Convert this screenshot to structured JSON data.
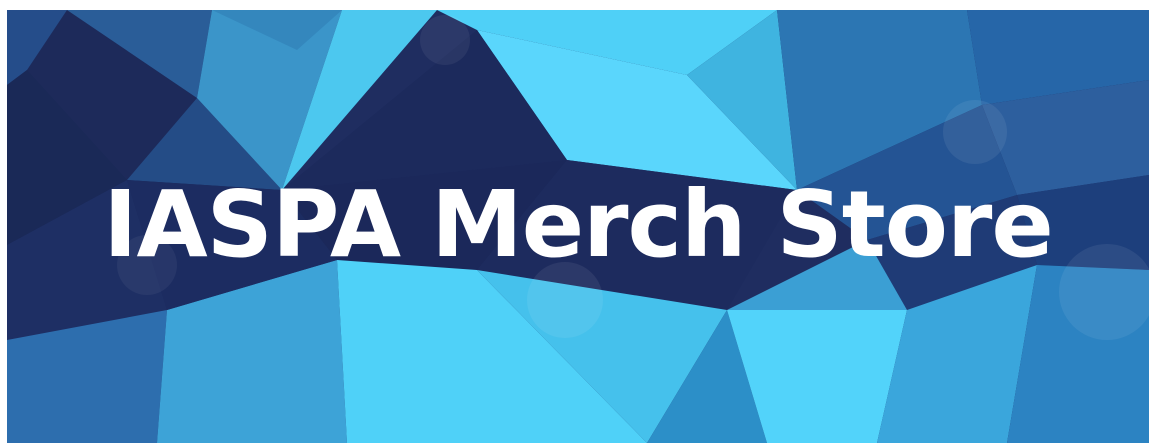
{
  "banner": {
    "title": "IASPA Merch Store",
    "background_colors": {
      "dark_navy": "#1d2a5c",
      "mid_blue": "#2f73b4",
      "light_cyan": "#4ccff5",
      "bright_cyan": "#5ad8ff"
    }
  }
}
